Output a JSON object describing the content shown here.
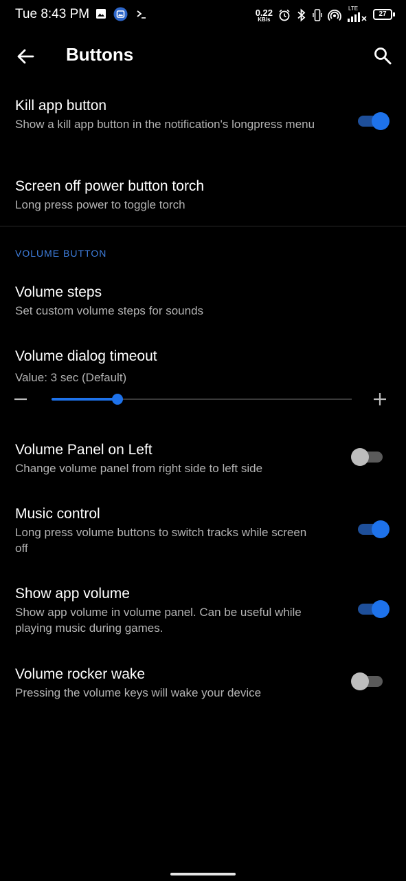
{
  "status_bar": {
    "time": "Tue 8:43 PM",
    "net_speed_value": "0.22",
    "net_speed_unit": "KB/s",
    "lte_label": "LTE",
    "battery": "27",
    "icons": [
      "image-icon",
      "app-badge-icon",
      "terminal-icon",
      "alarm-icon",
      "bluetooth-icon",
      "vibrate-icon",
      "hotspot-icon",
      "signal-icon",
      "battery-icon"
    ]
  },
  "header": {
    "title": "Buttons",
    "back_icon": "arrow-left-icon",
    "search_icon": "search-icon"
  },
  "prefs": {
    "kill_app": {
      "title": "Kill app button",
      "summary": "Show a kill app button in the notification's longpress menu",
      "enabled": true
    },
    "screen_off_torch": {
      "title": "Screen off power button torch",
      "summary": "Long press power to toggle torch"
    },
    "category": "VOLUME BUTTON",
    "volume_steps": {
      "title": "Volume steps",
      "summary": "Set custom volume steps for sounds"
    },
    "volume_timeout": {
      "title": "Volume dialog timeout",
      "summary": "Value: 3 sec (Default)",
      "slider_fraction": 0.22
    },
    "volume_panel_left": {
      "title": "Volume Panel on Left",
      "summary": "Change volume panel from right side to left side",
      "enabled": false
    },
    "music_control": {
      "title": "Music control",
      "summary": "Long press volume buttons to switch tracks while screen off",
      "enabled": true
    },
    "show_app_volume": {
      "title": "Show app volume",
      "summary": "Show app volume in volume panel. Can be useful while playing music during games.",
      "enabled": true
    },
    "volume_rocker_wake": {
      "title": "Volume rocker wake",
      "summary": "Pressing the volume keys will wake your device",
      "enabled": false
    }
  },
  "colors": {
    "accent": "#1e72ea",
    "category": "#3f7fdf",
    "background": "#000000",
    "summary_text": "#b3b3b3"
  }
}
